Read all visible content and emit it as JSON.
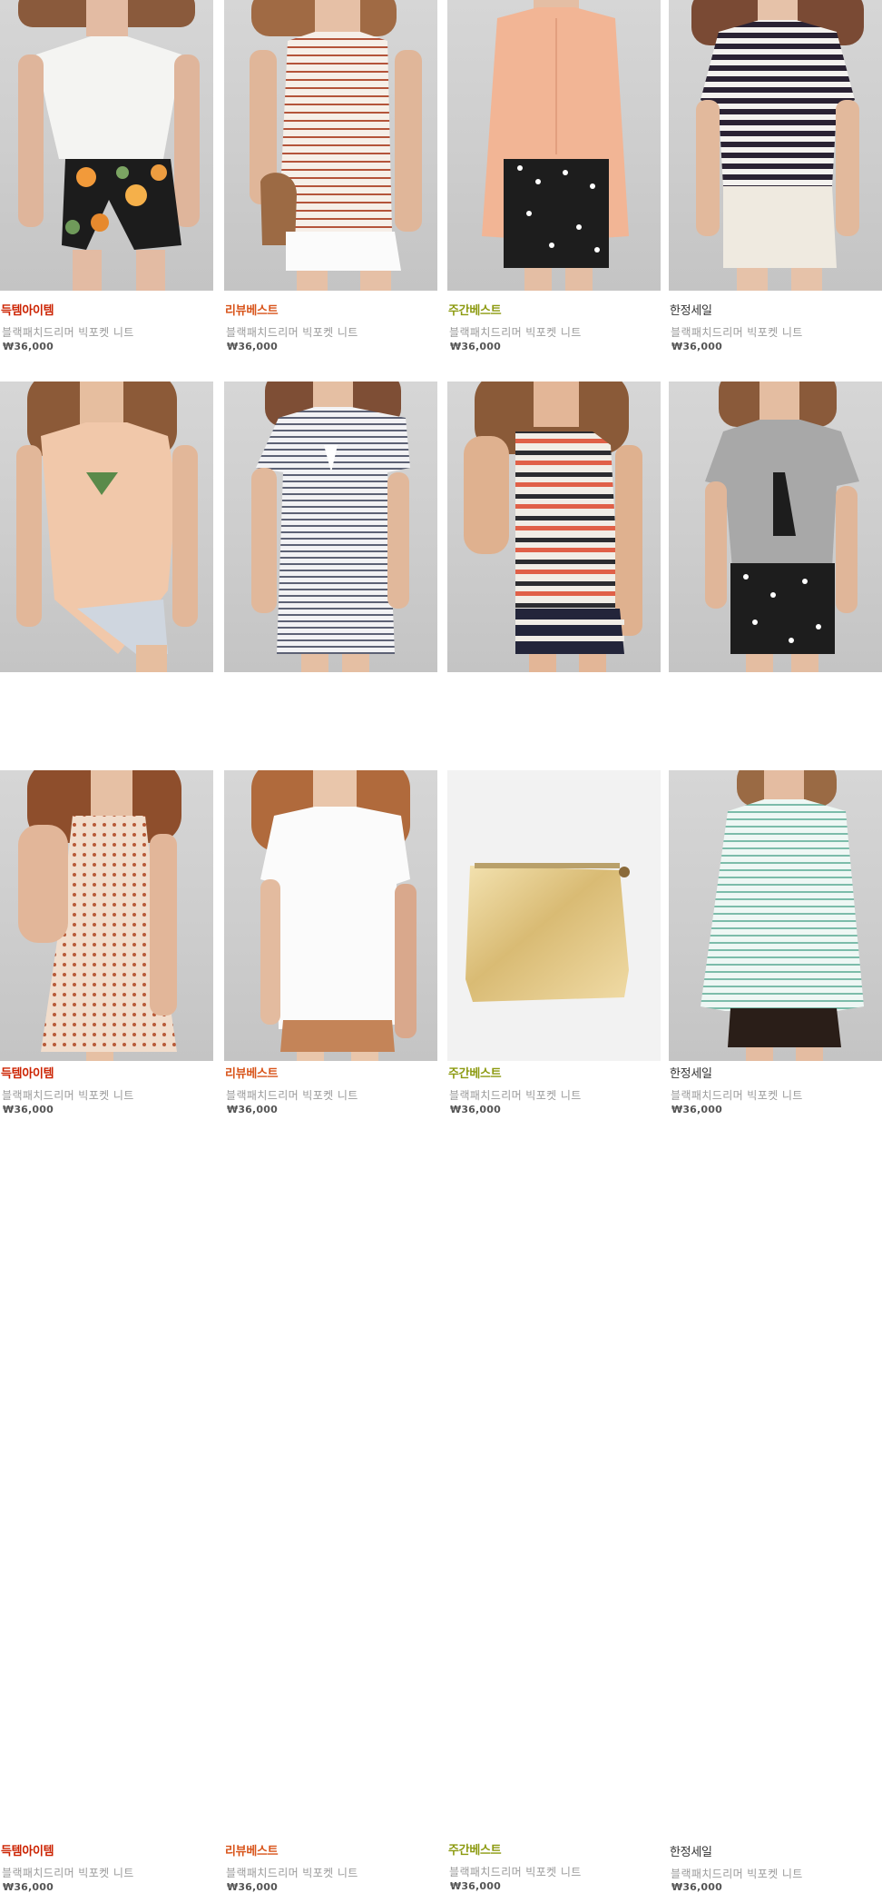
{
  "colors": {
    "tag_hot": "#cc2200",
    "tag_review": "#d8541a",
    "tag_weekly": "#8c9a10",
    "tag_sale": "#333333",
    "name": "#9a9a9a",
    "price": "#555555"
  },
  "products": [
    {
      "tag": "득템아이템",
      "tag_type": "hot",
      "name": "블랙패치드리머 빅포켓 니트",
      "price": "₩36,000",
      "image": "model in white cap-sleeve knit top and black floral shorts"
    },
    {
      "tag": "리뷰베스트",
      "tag_type": "review",
      "name": "블랙패치드리머 빅포켓 니트",
      "price": "₩36,000",
      "image": "model in red striped tank top, white shorts and fringe bag"
    },
    {
      "tag": "주간베스트",
      "tag_type": "weekly",
      "name": "블랙패치드리머 빅포켓 니트",
      "price": "₩36,000",
      "image": "model in peach silk blouse and black daisy shorts"
    },
    {
      "tag": "한정세일",
      "tag_type": "sale",
      "name": "블랙패치드리머 빅포켓 니트",
      "price": "₩36,000",
      "image": "model in navy striped tee and cream lace shorts"
    },
    {
      "tag": "득템아이템",
      "tag_type": "hot",
      "name": "블랙패치드리머 빅포켓 니트",
      "price": "₩36,000",
      "image": "model in peach draped tee and denim shorts"
    },
    {
      "tag": "리뷰베스트",
      "tag_type": "review",
      "name": "블랙패치드리머 빅포켓 니트",
      "price": "₩36,000",
      "image": "model in grey striped t-shirt dress"
    },
    {
      "tag": "주간베스트",
      "tag_type": "weekly",
      "name": "블랙패치드리머 빅포켓 니트",
      "price": "₩36,000",
      "image": "model in printed coast tank and striped shorts"
    },
    {
      "tag": "한정세일",
      "tag_type": "sale",
      "name": "블랙패치드리머 빅포켓 니트",
      "price": "₩36,000",
      "image": "model in grey bow top and black daisy shorts"
    },
    {
      "tag": "득템아이템",
      "tag_type": "hot",
      "name": "블랙패치드리머 빅포켓 니트",
      "price": "₩36,000",
      "image": "model in polka dot sundress"
    },
    {
      "tag": "리뷰베스트",
      "tag_type": "review",
      "name": "블랙패치드리머 빅포켓 니트",
      "price": "₩36,000",
      "image": "model in white v-neck tee and paisley shorts"
    },
    {
      "tag": "주간베스트",
      "tag_type": "weekly",
      "name": "블랙패치드리머 빅포켓 니트",
      "price": "₩36,000",
      "image": "gold metallic zip clutch"
    },
    {
      "tag": "한정세일",
      "tag_type": "sale",
      "name": "블랙패치드리머 빅포켓 니트",
      "price": "₩36,000",
      "image": "model in mint striped long-sleeve top and black shorts"
    }
  ]
}
